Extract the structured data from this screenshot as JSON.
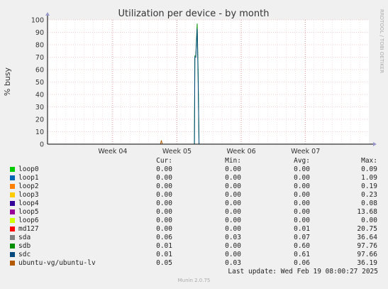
{
  "chart_data": {
    "type": "line",
    "title": "Utilization per device - by month",
    "ylabel": "% busy",
    "watermark": "RRDTOOL / TOBI OETIKER",
    "ylim": [
      0,
      100
    ],
    "yticks": [
      "0",
      "10",
      "20",
      "30",
      "40",
      "50",
      "60",
      "70",
      "80",
      "90",
      "100"
    ],
    "xticks": [
      "Week 04",
      "Week 05",
      "Week 06",
      "Week 07"
    ],
    "x_domain_days": [
      0,
      35
    ],
    "xtick_days": [
      7.1,
      14.1,
      21.1,
      28.1
    ],
    "series": [
      {
        "name": "loop0",
        "color": "#00cc00",
        "points": []
      },
      {
        "name": "loop1",
        "color": "#0066b3",
        "points": []
      },
      {
        "name": "loop2",
        "color": "#ff8000",
        "points": []
      },
      {
        "name": "loop3",
        "color": "#ffcc00",
        "points": []
      },
      {
        "name": "loop4",
        "color": "#330099",
        "points": []
      },
      {
        "name": "loop5",
        "color": "#990099",
        "points": []
      },
      {
        "name": "loop6",
        "color": "#ccff00",
        "points": []
      },
      {
        "name": "md127",
        "color": "#ff0000",
        "points": []
      },
      {
        "name": "sda",
        "color": "#808080",
        "points": []
      },
      {
        "name": "sdb",
        "color": "#008f00",
        "points": [
          [
            0,
            0
          ],
          [
            16.0,
            0
          ],
          [
            16.05,
            71
          ],
          [
            16.15,
            71
          ],
          [
            16.3,
            97
          ],
          [
            16.4,
            60
          ],
          [
            16.5,
            0
          ],
          [
            35,
            0
          ]
        ]
      },
      {
        "name": "sdc",
        "color": "#00487d",
        "points": [
          [
            0,
            0
          ],
          [
            16.0,
            0
          ],
          [
            16.05,
            70
          ],
          [
            16.15,
            70
          ],
          [
            16.3,
            93
          ],
          [
            16.4,
            55
          ],
          [
            16.5,
            0
          ],
          [
            35,
            0
          ]
        ]
      },
      {
        "name": "ubuntu-vg/ubuntu-lv",
        "color": "#b35a00",
        "points": [
          [
            0,
            0
          ],
          [
            12.3,
            0
          ],
          [
            12.4,
            3
          ],
          [
            12.5,
            0
          ],
          [
            35,
            0
          ]
        ]
      }
    ]
  },
  "legend": {
    "headers": {
      "cur": "Cur:",
      "min": "Min:",
      "avg": "Avg:",
      "max": "Max:"
    },
    "rows": [
      {
        "name": "loop0",
        "color": "#00cc00",
        "cur": "0.00",
        "min": "0.00",
        "avg": "0.00",
        "max": "0.09"
      },
      {
        "name": "loop1",
        "color": "#0066b3",
        "cur": "0.00",
        "min": "0.00",
        "avg": "0.00",
        "max": "1.09"
      },
      {
        "name": "loop2",
        "color": "#ff8000",
        "cur": "0.00",
        "min": "0.00",
        "avg": "0.00",
        "max": "0.19"
      },
      {
        "name": "loop3",
        "color": "#ffcc00",
        "cur": "0.00",
        "min": "0.00",
        "avg": "0.00",
        "max": "0.23"
      },
      {
        "name": "loop4",
        "color": "#330099",
        "cur": "0.00",
        "min": "0.00",
        "avg": "0.00",
        "max": "0.08"
      },
      {
        "name": "loop5",
        "color": "#990099",
        "cur": "0.00",
        "min": "0.00",
        "avg": "0.00",
        "max": "13.68"
      },
      {
        "name": "loop6",
        "color": "#ccff00",
        "cur": "0.00",
        "min": "0.00",
        "avg": "0.00",
        "max": "0.00"
      },
      {
        "name": "md127",
        "color": "#ff0000",
        "cur": "0.00",
        "min": "0.00",
        "avg": "0.01",
        "max": "20.75"
      },
      {
        "name": "sda",
        "color": "#808080",
        "cur": "0.06",
        "min": "0.03",
        "avg": "0.07",
        "max": "36.64"
      },
      {
        "name": "sdb",
        "color": "#008f00",
        "cur": "0.01",
        "min": "0.00",
        "avg": "0.60",
        "max": "97.76"
      },
      {
        "name": "sdc",
        "color": "#00487d",
        "cur": "0.01",
        "min": "0.00",
        "avg": "0.61",
        "max": "97.66"
      },
      {
        "name": "ubuntu-vg/ubuntu-lv",
        "color": "#b35a00",
        "cur": "0.05",
        "min": "0.03",
        "avg": "0.06",
        "max": "36.19"
      }
    ],
    "last_update": "Last update: Wed Feb 19 08:00:27 2025"
  },
  "footer": "Munin 2.0.75"
}
